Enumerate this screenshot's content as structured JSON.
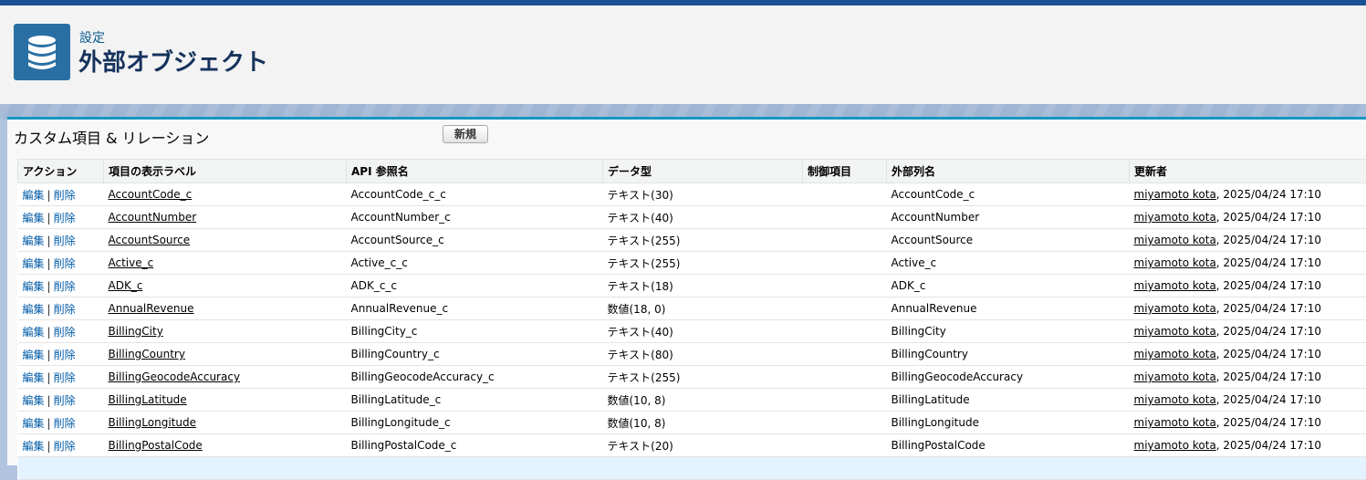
{
  "header": {
    "breadcrumb": "設定",
    "title": "外部オブジェクト"
  },
  "section": {
    "title": "カスタム項目 & リレーション",
    "new_button": "新規"
  },
  "table": {
    "columns": [
      "アクション",
      "項目の表示ラベル",
      "API 参照名",
      "データ型",
      "制御項目",
      "外部列名",
      "更新者"
    ],
    "edit_label": "編集",
    "delete_label": "削除",
    "rows": [
      {
        "label": "AccountCode_c",
        "api": "AccountCode_c_c",
        "type": "テキスト(30)",
        "control": "",
        "external": "AccountCode_c",
        "user": "miyamoto kota",
        "date": ", 2025/04/24 17:10"
      },
      {
        "label": "AccountNumber",
        "api": "AccountNumber_c",
        "type": "テキスト(40)",
        "control": "",
        "external": "AccountNumber",
        "user": "miyamoto kota",
        "date": ", 2025/04/24 17:10"
      },
      {
        "label": "AccountSource",
        "api": "AccountSource_c",
        "type": "テキスト(255)",
        "control": "",
        "external": "AccountSource",
        "user": "miyamoto kota",
        "date": ", 2025/04/24 17:10"
      },
      {
        "label": "Active_c",
        "api": "Active_c_c",
        "type": "テキスト(255)",
        "control": "",
        "external": "Active_c",
        "user": "miyamoto kota",
        "date": ", 2025/04/24 17:10"
      },
      {
        "label": "ADK_c",
        "api": "ADK_c_c",
        "type": "テキスト(18)",
        "control": "",
        "external": "ADK_c",
        "user": "miyamoto kota",
        "date": ", 2025/04/24 17:10"
      },
      {
        "label": "AnnualRevenue",
        "api": "AnnualRevenue_c",
        "type": "数値(18, 0)",
        "control": "",
        "external": "AnnualRevenue",
        "user": "miyamoto kota",
        "date": ", 2025/04/24 17:10"
      },
      {
        "label": "BillingCity",
        "api": "BillingCity_c",
        "type": "テキスト(40)",
        "control": "",
        "external": "BillingCity",
        "user": "miyamoto kota",
        "date": ", 2025/04/24 17:10"
      },
      {
        "label": "BillingCountry",
        "api": "BillingCountry_c",
        "type": "テキスト(80)",
        "control": "",
        "external": "BillingCountry",
        "user": "miyamoto kota",
        "date": ", 2025/04/24 17:10"
      },
      {
        "label": "BillingGeocodeAccuracy",
        "api": "BillingGeocodeAccuracy_c",
        "type": "テキスト(255)",
        "control": "",
        "external": "BillingGeocodeAccuracy",
        "user": "miyamoto kota",
        "date": ", 2025/04/24 17:10"
      },
      {
        "label": "BillingLatitude",
        "api": "BillingLatitude_c",
        "type": "数値(10, 8)",
        "control": "",
        "external": "BillingLatitude",
        "user": "miyamoto kota",
        "date": ", 2025/04/24 17:10"
      },
      {
        "label": "BillingLongitude",
        "api": "BillingLongitude_c",
        "type": "数値(10, 8)",
        "control": "",
        "external": "BillingLongitude",
        "user": "miyamoto kota",
        "date": ", 2025/04/24 17:10"
      },
      {
        "label": "BillingPostalCode",
        "api": "BillingPostalCode_c",
        "type": "テキスト(20)",
        "control": "",
        "external": "BillingPostalCode",
        "user": "miyamoto kota",
        "date": ", 2025/04/24 17:10"
      }
    ]
  }
}
